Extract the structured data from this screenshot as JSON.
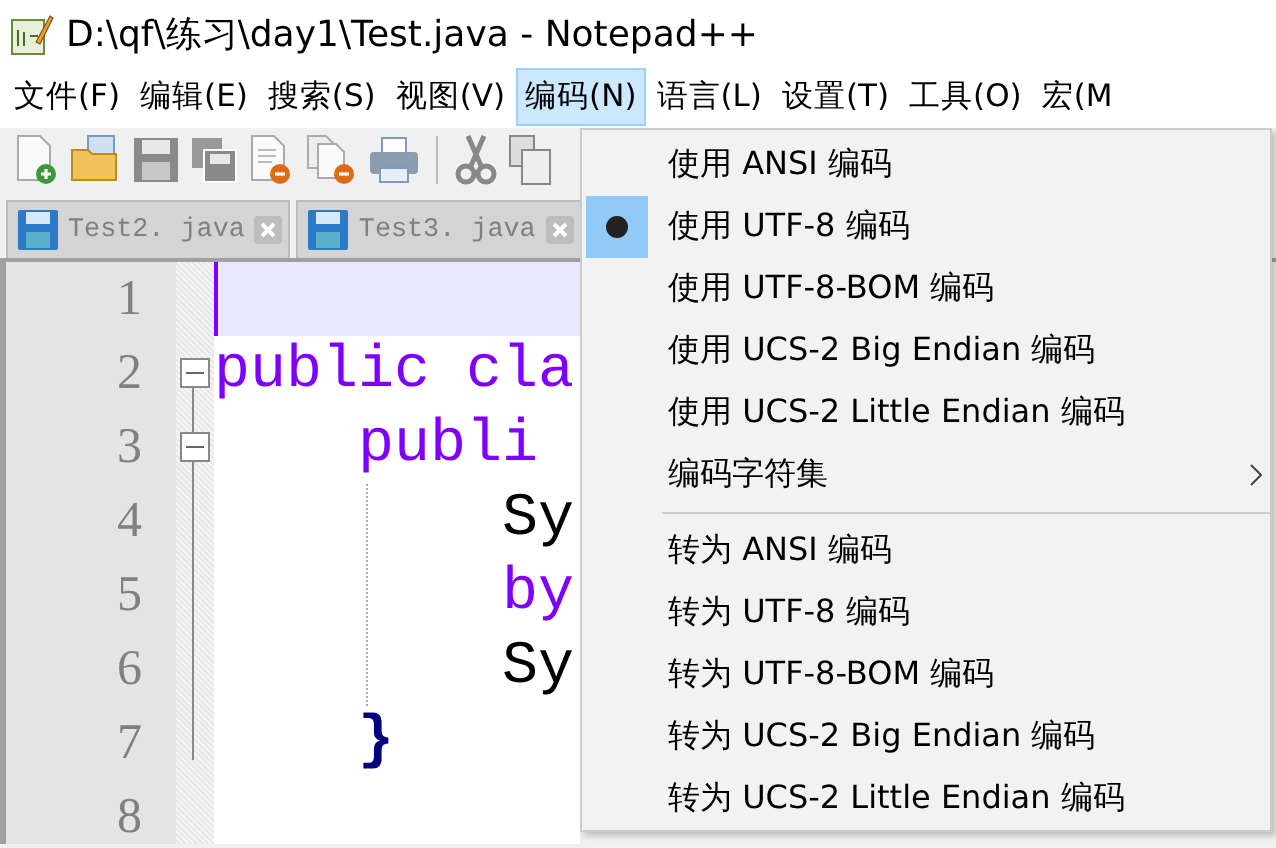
{
  "window": {
    "title": "D:\\qf\\练习\\day1\\Test.java - Notepad++"
  },
  "menu_bar": [
    {
      "label": "文件(F)",
      "selected": false
    },
    {
      "label": "编辑(E)",
      "selected": false
    },
    {
      "label": "搜索(S)",
      "selected": false
    },
    {
      "label": "视图(V)",
      "selected": false
    },
    {
      "label": "编码(N)",
      "selected": true
    },
    {
      "label": "语言(L)",
      "selected": false
    },
    {
      "label": "设置(T)",
      "selected": false
    },
    {
      "label": "工具(O)",
      "selected": false
    },
    {
      "label": "宏(M",
      "selected": false
    }
  ],
  "tabs": [
    {
      "label": "Test2. java"
    },
    {
      "label": "Test3. java"
    }
  ],
  "editor": {
    "lines": [
      {
        "number": "1",
        "current": true,
        "fold_marker": false
      },
      {
        "number": "2",
        "text": "public cla",
        "kind": "keyword",
        "current": false,
        "fold_marker": true
      },
      {
        "number": "3",
        "text": "    publi",
        "kind": "keyword",
        "current": false,
        "fold_marker": true
      },
      {
        "number": "4",
        "text": "        Sy",
        "kind": "plain",
        "current": false,
        "fold_marker": false
      },
      {
        "number": "5",
        "text": "        by",
        "kind": "keyword",
        "current": false,
        "fold_marker": false
      },
      {
        "number": "6",
        "text": "        Sy",
        "kind": "plain",
        "current": false,
        "fold_marker": false
      },
      {
        "number": "7",
        "text": "    }",
        "kind": "brace",
        "current": false,
        "fold_marker": false
      },
      {
        "number": "8",
        "current": false,
        "fold_marker": false
      }
    ]
  },
  "encoding_menu": [
    {
      "kind": "item",
      "label": "使用 ANSI 编码",
      "selected": false
    },
    {
      "kind": "item",
      "label": "使用 UTF-8 编码",
      "selected": true
    },
    {
      "kind": "item",
      "label": "使用 UTF-8-BOM 编码",
      "selected": false
    },
    {
      "kind": "item",
      "label": "使用 UCS-2 Big Endian 编码",
      "selected": false
    },
    {
      "kind": "item",
      "label": "使用 UCS-2 Little Endian 编码",
      "selected": false
    },
    {
      "kind": "submenu",
      "label": "编码字符集",
      "selected": false
    },
    {
      "kind": "separator"
    },
    {
      "kind": "item",
      "label": "转为 ANSI 编码",
      "selected": false
    },
    {
      "kind": "item",
      "label": "转为 UTF-8 编码",
      "selected": false
    },
    {
      "kind": "item",
      "label": "转为 UTF-8-BOM 编码",
      "selected": false
    },
    {
      "kind": "item",
      "label": "转为 UCS-2 Big Endian 编码",
      "selected": false
    },
    {
      "kind": "item",
      "label": "转为 UCS-2 Little Endian 编码",
      "selected": false
    }
  ]
}
